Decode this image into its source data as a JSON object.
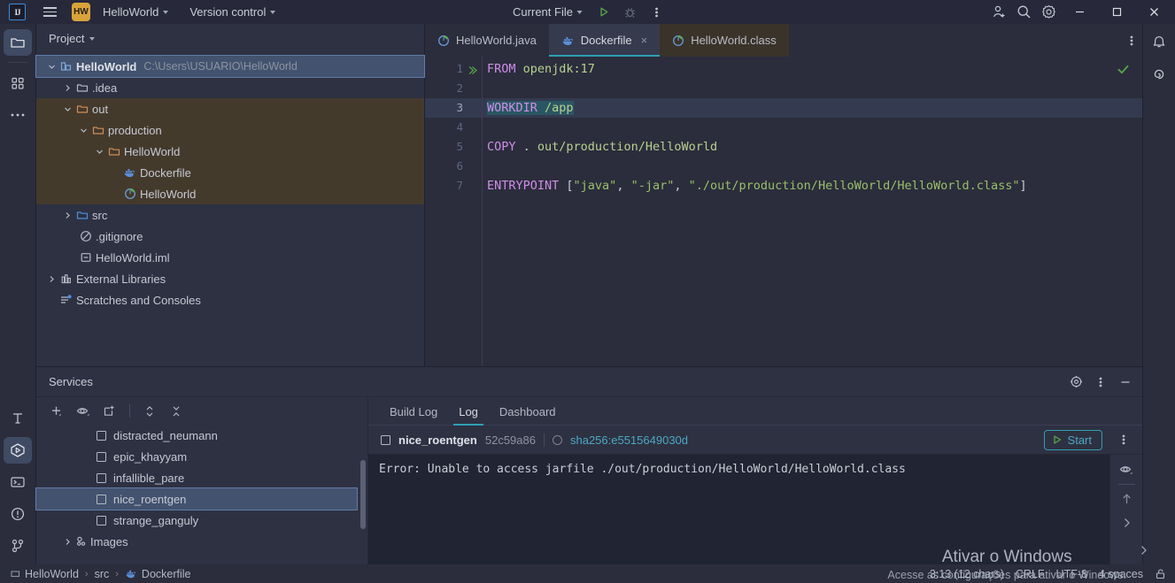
{
  "titlebar": {
    "logo": "IJ",
    "project_badge": "HW",
    "project_name": "HelloWorld",
    "version_control": "Version control",
    "run_config": "Current File",
    "icons": {
      "menu": "hamburger-menu-icon",
      "run": "run-icon",
      "debug": "debug-icon",
      "more": "more-vertical-icon",
      "account": "add-account-icon",
      "search": "search-icon",
      "settings": "settings-gear-icon",
      "minimize": "minimize-icon",
      "maximize": "maximize-icon",
      "close": "close-icon"
    }
  },
  "left_rail": {
    "items": [
      {
        "name": "project-tool-window",
        "icon": "folder-icon",
        "active": true
      },
      {
        "name": "structure-tool-window",
        "icon": "structure-icon",
        "active": false
      },
      {
        "name": "more-tool-windows",
        "icon": "more-horizontal-icon",
        "active": false
      }
    ],
    "bottom_items": [
      {
        "name": "build-tool-window",
        "icon": "hammer-icon",
        "active": false
      },
      {
        "name": "services-tool-window",
        "icon": "services-icon",
        "active": true
      },
      {
        "name": "terminal-tool-window",
        "icon": "terminal-icon",
        "active": false
      },
      {
        "name": "problems-tool-window",
        "icon": "warning-circle-icon",
        "active": false
      },
      {
        "name": "version-control-tool-window",
        "icon": "git-branch-icon",
        "active": false
      }
    ]
  },
  "right_rail": {
    "items": [
      {
        "name": "notifications",
        "icon": "bell-icon"
      },
      {
        "name": "ai-assistant",
        "icon": "spiral-icon"
      }
    ]
  },
  "project_panel": {
    "title": "Project",
    "tree": [
      {
        "label": "HelloWorld",
        "path": "C:\\Users\\USUARIO\\HelloWorld",
        "indent": 0,
        "arrow": "down",
        "icon": "project-icon",
        "selected": true,
        "bold": true
      },
      {
        "label": ".idea",
        "indent": 1,
        "arrow": "right",
        "icon": "folder-icon"
      },
      {
        "label": "out",
        "indent": 1,
        "arrow": "down",
        "icon": "folder-orange-icon",
        "excluded": true
      },
      {
        "label": "production",
        "indent": 2,
        "arrow": "down",
        "icon": "folder-orange-icon",
        "excluded": true
      },
      {
        "label": "HelloWorld",
        "indent": 3,
        "arrow": "down",
        "icon": "folder-orange-icon",
        "excluded": true
      },
      {
        "label": "Dockerfile",
        "indent": 4,
        "arrow": "none",
        "icon": "docker-icon",
        "excluded": true
      },
      {
        "label": "HelloWorld",
        "indent": 4,
        "arrow": "none",
        "icon": "java-class-icon",
        "excluded": true
      },
      {
        "label": "src",
        "indent": 1,
        "arrow": "right",
        "icon": "folder-blue-icon"
      },
      {
        "label": ".gitignore",
        "indent": 2,
        "arrow": "none",
        "icon": "gitignore-icon"
      },
      {
        "label": "HelloWorld.iml",
        "indent": 2,
        "arrow": "none",
        "icon": "iml-icon"
      },
      {
        "label": "External Libraries",
        "indent": 0,
        "arrow": "right",
        "icon": "libraries-icon"
      },
      {
        "label": "Scratches and Consoles",
        "indent": 0,
        "arrow": "none",
        "icon": "scratches-icon"
      }
    ]
  },
  "editor": {
    "tabs": [
      {
        "label": "HelloWorld.java",
        "icon": "java-class-icon",
        "active": false,
        "closable": false
      },
      {
        "label": "Dockerfile",
        "icon": "docker-icon",
        "active": true,
        "closable": true,
        "close_label": "×"
      },
      {
        "label": "HelloWorld.class",
        "icon": "java-class-icon",
        "active": false,
        "closable": false
      }
    ],
    "more_icon": "more-vertical-icon",
    "inspection_status": "ok-check-icon",
    "lines": [
      {
        "num": "1",
        "runnable": true,
        "current": false,
        "tokens": [
          {
            "t": "FROM",
            "c": "kw"
          },
          {
            "t": " ",
            "c": "plain"
          },
          {
            "t": "openjdk:17",
            "c": "arg"
          }
        ]
      },
      {
        "num": "2",
        "runnable": false,
        "current": false,
        "tokens": []
      },
      {
        "num": "3",
        "runnable": false,
        "current": true,
        "tokens": [
          {
            "t": "WORKDIR",
            "c": "kw sel-text"
          },
          {
            "t": " ",
            "c": "plain sel-text"
          },
          {
            "t": "/app",
            "c": "arg sel-text"
          }
        ]
      },
      {
        "num": "4",
        "runnable": false,
        "current": false,
        "tokens": []
      },
      {
        "num": "5",
        "runnable": false,
        "current": false,
        "tokens": [
          {
            "t": "COPY",
            "c": "kw"
          },
          {
            "t": " . ",
            "c": "plain"
          },
          {
            "t": "out/production/HelloWorld",
            "c": "arg"
          }
        ]
      },
      {
        "num": "6",
        "runnable": false,
        "current": false,
        "tokens": []
      },
      {
        "num": "7",
        "runnable": false,
        "current": false,
        "tokens": [
          {
            "t": "ENTRYPOINT",
            "c": "kw"
          },
          {
            "t": " [",
            "c": "plain"
          },
          {
            "t": "\"java\"",
            "c": "str"
          },
          {
            "t": ", ",
            "c": "plain"
          },
          {
            "t": "\"-jar\"",
            "c": "str"
          },
          {
            "t": ", ",
            "c": "plain"
          },
          {
            "t": "\"./out/production/HelloWorld/HelloWorld.class\"",
            "c": "str"
          },
          {
            "t": "]",
            "c": "plain"
          }
        ]
      }
    ]
  },
  "services": {
    "title": "Services",
    "header_icons": {
      "settings": "target-settings-icon",
      "more": "more-vertical-icon",
      "minimize": "minimize-icon"
    },
    "toolbar_icons": [
      {
        "name": "add-service-button",
        "icon": "plus-icon"
      },
      {
        "name": "show-hide-button",
        "icon": "eye-icon"
      },
      {
        "name": "new-container-button",
        "icon": "new-window-icon"
      },
      {
        "name": "expand-collapse-button",
        "icon": "updown-arrows-icon"
      },
      {
        "name": "collapse-all-button",
        "icon": "collapse-all-icon"
      }
    ],
    "containers": [
      {
        "label": "distracted_neumann",
        "selected": false
      },
      {
        "label": "epic_khayyam",
        "selected": false
      },
      {
        "label": "infallible_pare",
        "selected": false
      },
      {
        "label": "nice_roentgen",
        "selected": true
      },
      {
        "label": "strange_ganguly",
        "selected": false
      }
    ],
    "images_node": {
      "label": "Images",
      "icon": "images-icon",
      "arrow": "right"
    },
    "log_tabs": [
      {
        "label": "Build Log",
        "active": false
      },
      {
        "label": "Log",
        "active": true
      },
      {
        "label": "Dashboard",
        "active": false
      }
    ],
    "container_header": {
      "name": "nice_roentgen",
      "id": "52c59a86",
      "image_sha": "sha256:e5515649030d",
      "start_button": "Start",
      "more_icon": "more-vertical-icon"
    },
    "log_output": "Error: Unable to access jarfile ./out/production/HelloWorld/HelloWorld.class",
    "log_rail_icons": [
      {
        "name": "soft-wrap-button",
        "icon": "eye-icon"
      },
      {
        "name": "scroll-to-top-button",
        "icon": "arrow-up-icon"
      },
      {
        "name": "expand-panel-button",
        "icon": "chevron-right-icon"
      }
    ]
  },
  "statusbar": {
    "breadcrumbs": [
      {
        "label": "HelloWorld",
        "icon": "project-small-icon"
      },
      {
        "label": "src",
        "icon": "none"
      },
      {
        "label": "Dockerfile",
        "icon": "docker-icon"
      }
    ],
    "separator": "›",
    "caret_position": "3:13 (12 chars)",
    "line_separator": "CRLF",
    "encoding": "UTF-8",
    "indent": "4 spaces",
    "lock_icon": "unlocked-icon"
  },
  "watermark": {
    "line1": "Ativar o Windows",
    "line2": "Acesse as configurações para ativar o Windows."
  },
  "colors": {
    "accent": "#2f9fb5",
    "selection": "#43526e",
    "excluded_folder": "#443a2c",
    "keyword": "#cf8ee8",
    "string": "#9bbf6a",
    "argument": "#b9d08e",
    "link": "#4ca8c2",
    "run_green": "#4f9e4f"
  }
}
